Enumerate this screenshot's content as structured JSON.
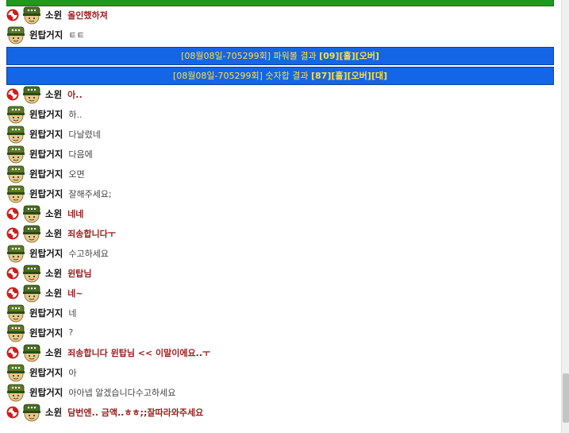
{
  "top_banner": {
    "label": "",
    "color": "#1e9b1e"
  },
  "results": [
    {
      "label": "[08월08일-705299회] 파워볼 결과 ",
      "value": "[09][홀][오버]"
    },
    {
      "label": "[08월08일-705299회] 숫자합 결과 ",
      "value": "[87][홀][오버][대]"
    }
  ],
  "messages": [
    {
      "user": "소윈",
      "type": "manager",
      "text": "올인했하져"
    },
    {
      "user": "윈탑거지",
      "type": "member",
      "text": "ㅌㅌ"
    },
    {
      "user": "소윈",
      "type": "manager",
      "text": "아.."
    },
    {
      "user": "윈탑거지",
      "type": "member",
      "text": "하.."
    },
    {
      "user": "윈탑거지",
      "type": "member",
      "text": "다날렸네"
    },
    {
      "user": "윈탑거지",
      "type": "member",
      "text": "다음에"
    },
    {
      "user": "윈탑거지",
      "type": "member",
      "text": "오면"
    },
    {
      "user": "윈탑거지",
      "type": "member",
      "text": "잘해주세요;"
    },
    {
      "user": "소윈",
      "type": "manager",
      "text": "네네"
    },
    {
      "user": "소윈",
      "type": "manager",
      "text": "죄송합니다ㅜ"
    },
    {
      "user": "윈탑거지",
      "type": "member",
      "text": "수고하세요"
    },
    {
      "user": "소윈",
      "type": "manager",
      "text": "윈탑님"
    },
    {
      "user": "소윈",
      "type": "manager",
      "text": "네~"
    },
    {
      "user": "윈탑거지",
      "type": "member",
      "text": "네"
    },
    {
      "user": "윈탑거지",
      "type": "member",
      "text": "?"
    },
    {
      "user": "소윈",
      "type": "manager",
      "text": "죄송합니다 윈탑님 << 이말이에요..ㅜ"
    },
    {
      "user": "윈탑거지",
      "type": "member",
      "text": "아"
    },
    {
      "user": "윈탑거지",
      "type": "member",
      "text": "아아넵 알겠습니다수고하세요"
    },
    {
      "user": "소윈",
      "type": "manager",
      "text": "담번엔.. 금액..ㅎㅎ;;잘따라와주세요"
    }
  ],
  "icons": {
    "manager": "swirl-icon",
    "avatar": "army-cap-icon"
  },
  "colors": {
    "banner_bg": "#1466e6",
    "banner_text": "#ffe03a",
    "manager_text": "#9b1c1c"
  }
}
